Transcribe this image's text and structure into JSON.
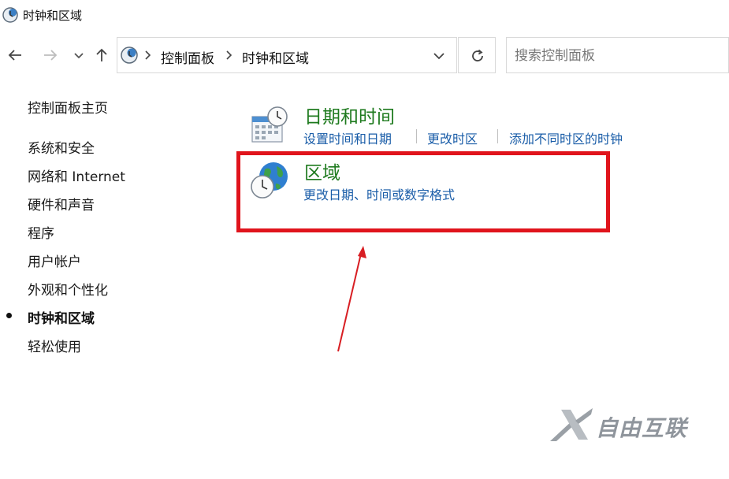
{
  "window": {
    "title": "时钟和区域",
    "icon": "control-panel-clock-icon"
  },
  "navigation": {
    "back_icon": "back-arrow-icon",
    "forward_icon": "forward-arrow-icon",
    "recent_icon": "chevron-down-icon",
    "up_icon": "up-arrow-icon"
  },
  "address": {
    "crumbs": [
      "控制面板",
      "时钟和区域"
    ],
    "dropdown_icon": "chevron-down-icon",
    "refresh_icon": "refresh-icon"
  },
  "search": {
    "placeholder": "搜索控制面板",
    "value": ""
  },
  "sidebar": {
    "home": "控制面板主页",
    "items": [
      {
        "label": "系统和安全",
        "active": false
      },
      {
        "label": "网络和 Internet",
        "active": false
      },
      {
        "label": "硬件和声音",
        "active": false
      },
      {
        "label": "程序",
        "active": false
      },
      {
        "label": "用户帐户",
        "active": false
      },
      {
        "label": "外观和个性化",
        "active": false
      },
      {
        "label": "时钟和区域",
        "active": true
      },
      {
        "label": "轻松使用",
        "active": false
      }
    ]
  },
  "categories": [
    {
      "title": "日期和时间",
      "icon": "calendar-clock-icon",
      "links": [
        "设置时间和日期",
        "更改时区",
        "添加不同时区的时钟"
      ]
    },
    {
      "title": "区域",
      "icon": "globe-clock-icon",
      "links": [
        "更改日期、时间或数字格式"
      ]
    }
  ],
  "annotation": {
    "color": "#e0141c"
  },
  "colors": {
    "category_title": "#1e7a1e",
    "link": "#1a5da8"
  },
  "watermark": {
    "text": "自由互联"
  }
}
